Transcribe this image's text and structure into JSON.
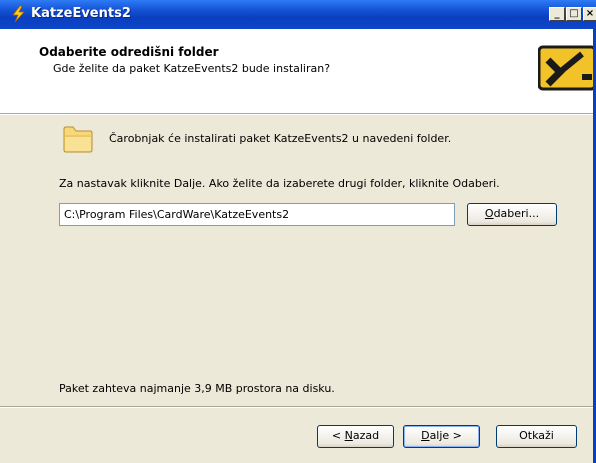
{
  "window": {
    "title": "KatzeEvents2",
    "minimize_glyph": "_",
    "maximize_glyph": "□",
    "close_glyph": "×"
  },
  "header": {
    "title": "Odaberite odredišni folder",
    "subtitle": "Gde želite da paket KatzeEvents2 bude instaliran?"
  },
  "content": {
    "intro": "Čarobnjak će instalirati paket KatzeEvents2 u navedeni folder.",
    "instructions": "Za nastavak kliknite Dalje. Ako želite da izaberete drugi folder, kliknite Odaberi.",
    "install_path": "C:\\Program Files\\CardWare\\KatzeEvents2",
    "browse_label_u": "O",
    "browse_label_rest": "daberi...",
    "disk_space": "Paket zahteva najmanje 3,9 MB prostora na disku."
  },
  "footer": {
    "back_prefix": "< ",
    "back_u": "N",
    "back_rest": "azad",
    "next_u": "D",
    "next_rest": "alje >",
    "cancel_label": "Otkaži"
  },
  "colors": {
    "titlebar": "#0a3fbf",
    "dialog_bg": "#ece9d8",
    "folder": "#f6d77c"
  },
  "icons": {
    "title": "lightning-icon",
    "header": "wizard-icon",
    "folder": "folder-icon"
  }
}
